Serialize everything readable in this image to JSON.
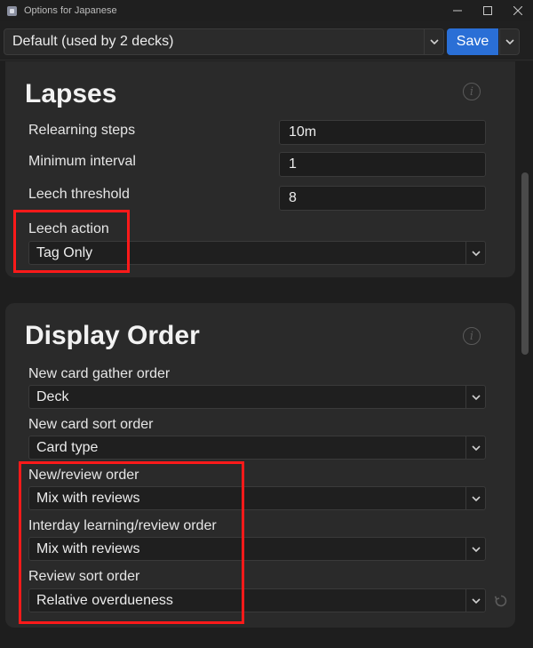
{
  "window": {
    "title": "Options for Japanese"
  },
  "toolbar": {
    "preset_value": "Default (used by 2 decks)",
    "save_label": "Save"
  },
  "lapses": {
    "title": "Lapses",
    "relearning_steps_label": "Relearning steps",
    "relearning_steps_value": "10m",
    "minimum_interval_label": "Minimum interval",
    "minimum_interval_value": "1",
    "leech_threshold_label": "Leech threshold",
    "leech_threshold_value": "8",
    "leech_action_label": "Leech action",
    "leech_action_value": "Tag Only"
  },
  "display_order": {
    "title": "Display Order",
    "new_card_gather_label": "New card gather order",
    "new_card_gather_value": "Deck",
    "new_card_sort_label": "New card sort order",
    "new_card_sort_value": "Card type",
    "new_review_label": "New/review order",
    "new_review_value": "Mix with reviews",
    "interday_label": "Interday learning/review order",
    "interday_value": "Mix with reviews",
    "review_sort_label": "Review sort order",
    "review_sort_value": "Relative overdueness"
  },
  "icons": {
    "info": "info-icon",
    "chevron": "chevron-down-icon",
    "revert": "revert-icon"
  },
  "colors": {
    "accent": "#2a6fd6",
    "highlight": "#ff1a1a",
    "background": "#1e1e1e",
    "card": "#2a2a2a"
  }
}
